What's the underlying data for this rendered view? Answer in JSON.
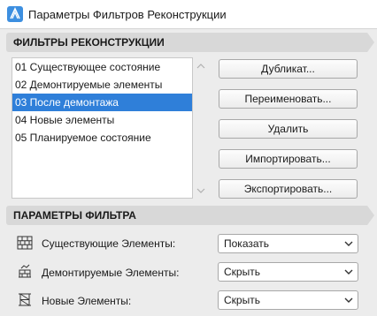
{
  "window": {
    "title": "Параметры Фильтров Реконструкции"
  },
  "filters_section": {
    "header": "ФИЛЬТРЫ РЕКОНСТРУКЦИИ",
    "items": [
      {
        "label": "01 Существующее состояние"
      },
      {
        "label": "02 Демонтируемые элементы"
      },
      {
        "label": "03 После демонтажа",
        "selected": true
      },
      {
        "label": "04 Новые элементы"
      },
      {
        "label": "05 Планируемое состояние"
      }
    ],
    "buttons": {
      "duplicate": "Дубликат...",
      "rename": "Переименовать...",
      "delete": "Удалить",
      "import": "Импортировать...",
      "export": "Экспортировать..."
    }
  },
  "params_section": {
    "header": "ПАРАМЕТРЫ ФИЛЬТРА",
    "rows": [
      {
        "label": "Существующие Элементы:",
        "value": "Показать",
        "icon": "existing-elements-icon"
      },
      {
        "label": "Демонтируемые Элементы:",
        "value": "Скрыть",
        "icon": "demolished-elements-icon"
      },
      {
        "label": "Новые Элементы:",
        "value": "Скрыть",
        "icon": "new-elements-icon"
      }
    ]
  },
  "colors": {
    "selection": "#2f7fd9",
    "header_bg": "#d8d8d8",
    "window_bg": "#ececec"
  }
}
